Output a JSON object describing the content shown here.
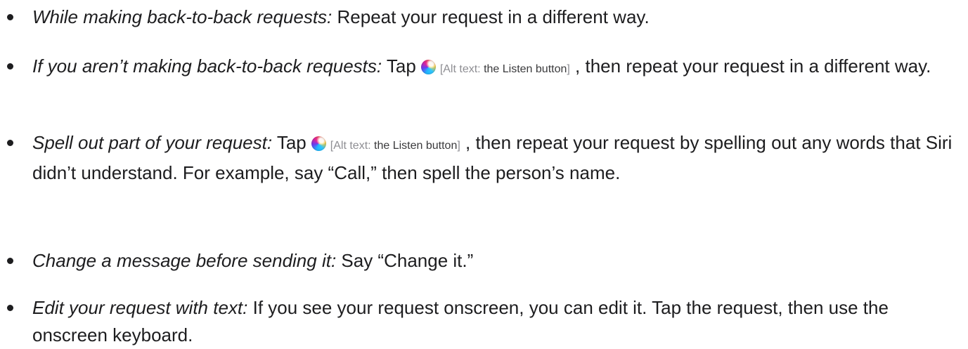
{
  "items": [
    {
      "lead": "While making back-to-back requests:",
      "text": " Repeat your request in a different way."
    },
    {
      "lead": "If you aren’t making back-to-back requests:",
      "before": " Tap",
      "icon": "siri-listen-icon",
      "alt_prefix": "[Alt text: ",
      "alt_value": "the Listen button",
      "alt_suffix": "]",
      "after": " , then repeat your request in a different way."
    },
    {
      "lead": "Spell out part of your request:",
      "before": " Tap",
      "icon": "siri-listen-icon",
      "alt_prefix": "[Alt text: ",
      "alt_value": "the Listen button",
      "alt_suffix": "]",
      "after": " , then repeat your request by spelling out any words that Siri didn’t understand. For example, say “Call,” then spell the person’s name."
    },
    {
      "lead": "Change a message before sending it:",
      "text": " Say “Change it.”"
    },
    {
      "lead": "Edit your request with text:",
      "text": " If you see your request onscreen, you can edit it. Tap the request, then use the onscreen keyboard."
    }
  ]
}
